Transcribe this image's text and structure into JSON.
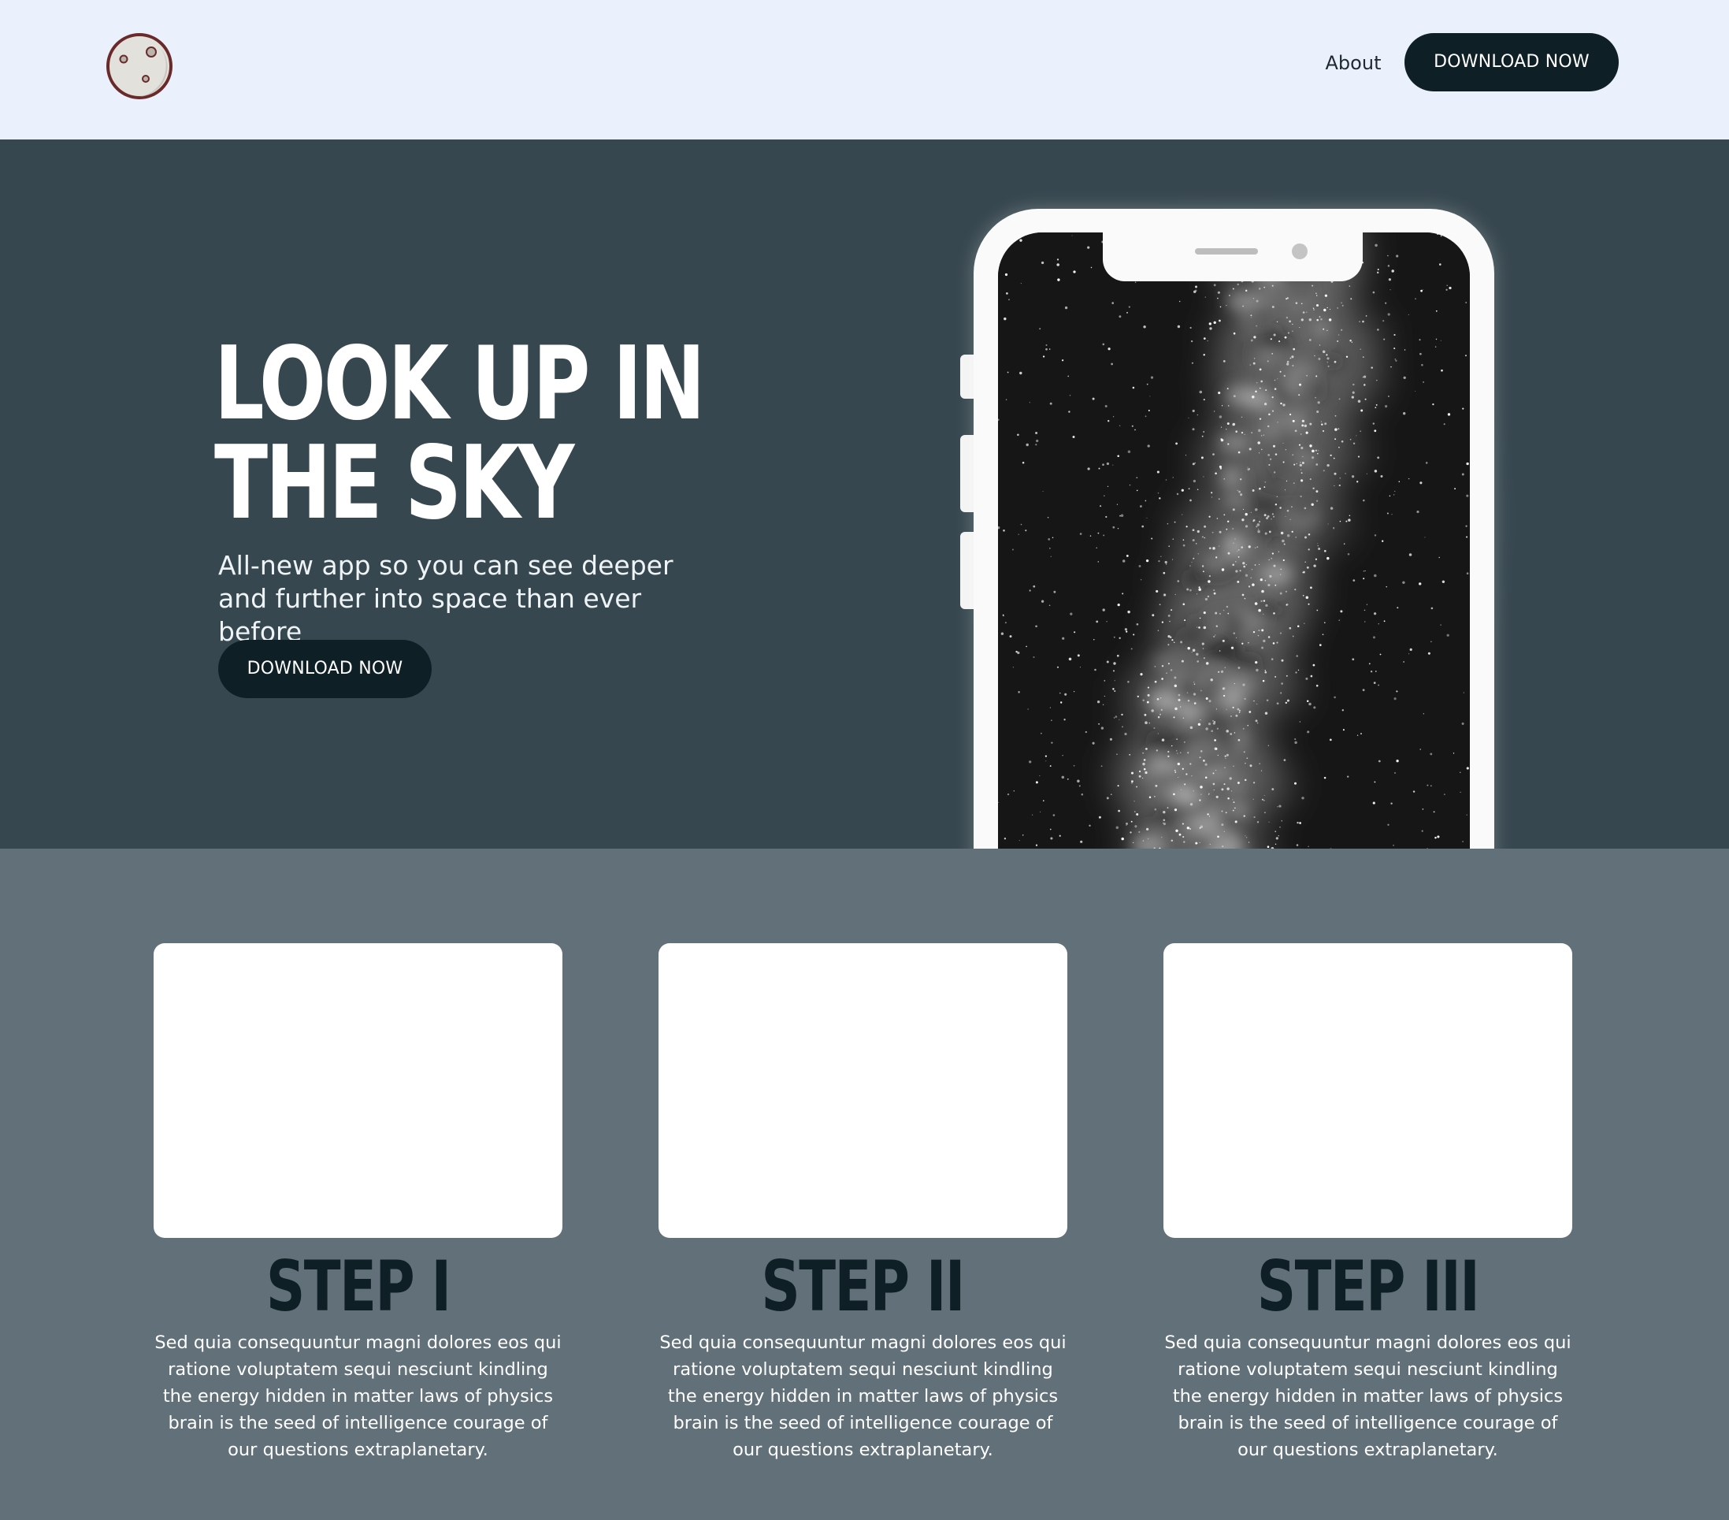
{
  "header": {
    "logo_icon": "moon-icon",
    "nav": {
      "about_label": "About",
      "download_label": "DOWNLOAD NOW"
    }
  },
  "hero": {
    "title_line1": "LOOK UP IN",
    "title_line2": "THE SKY",
    "subtitle": "All-new app so you can see deeper and further into space than ever before",
    "download_label": "DOWNLOAD NOW",
    "phone_image": "milky-way-night-sky"
  },
  "steps": [
    {
      "title": "STEP I",
      "text": "Sed quia consequuntur magni dolores eos qui ratione voluptatem sequi nesciunt kindling the energy hidden in matter laws of physics brain is the seed of intelligence courage of our questions extraplanetary."
    },
    {
      "title": "STEP II",
      "text": "Sed quia consequuntur magni dolores eos qui ratione voluptatem sequi nesciunt kindling the energy hidden in matter laws of physics brain is the seed of intelligence courage of our questions extraplanetary."
    },
    {
      "title": "STEP III",
      "text": "Sed quia consequuntur magni dolores eos qui ratione voluptatem sequi nesciunt kindling the energy hidden in matter laws of physics brain is the seed of intelligence courage of our questions extraplanetary."
    }
  ],
  "colors": {
    "header_bg": "#eaf1fd",
    "hero_bg": "#37474f",
    "steps_bg": "#627179",
    "button_bg": "#0f1f26",
    "logo_fill": "#e3e1dc",
    "logo_stroke": "#6b2a2a"
  }
}
